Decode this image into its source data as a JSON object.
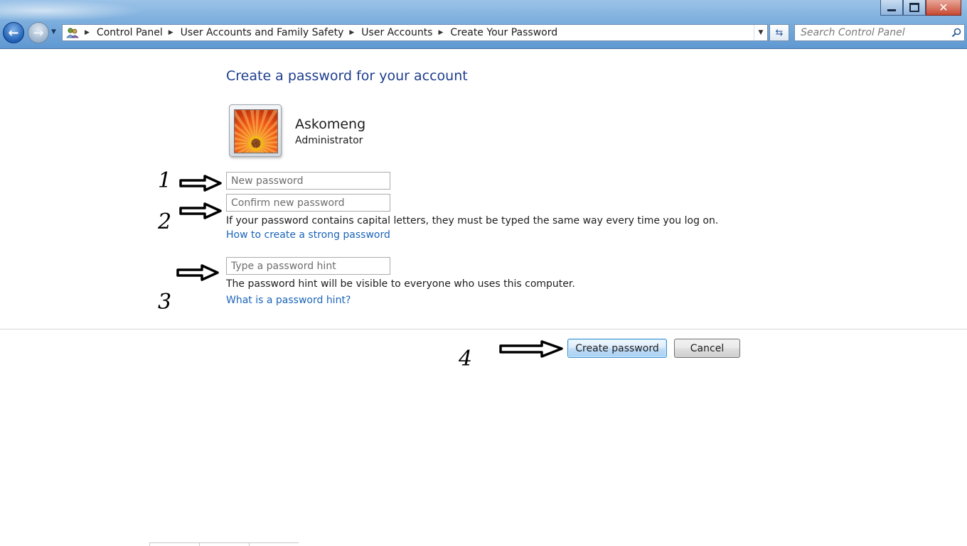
{
  "window": {
    "minimize_label": "",
    "maximize_label": "",
    "close_label": "✕"
  },
  "nav": {
    "back_glyph": "←",
    "forward_glyph": "→",
    "history_glyph": "▼"
  },
  "address_bar": {
    "icon": "control-panel-icon",
    "breadcrumbs": [
      "Control Panel",
      "User Accounts and Family Safety",
      "User Accounts",
      "Create Your Password"
    ],
    "separator_glyph": "▶",
    "dropdown_glyph": "▼",
    "refresh_glyph": "⇆"
  },
  "search": {
    "placeholder": "Search Control Panel"
  },
  "page": {
    "title": "Create a password for your account"
  },
  "user": {
    "name": "Askomeng",
    "role": "Administrator"
  },
  "form": {
    "new_password_placeholder": "New password",
    "confirm_password_placeholder": "Confirm new password",
    "caps_note": "If your password contains capital letters, they must be typed the same way every time you log on.",
    "strong_password_link": "How to create a strong password",
    "hint_placeholder": "Type a password hint",
    "hint_note": "The password hint will be visible to everyone who uses this computer.",
    "hint_link": "What is a password hint?"
  },
  "buttons": {
    "create": "Create password",
    "cancel": "Cancel"
  },
  "annotations": {
    "step1": "1",
    "step2": "2",
    "step3": "3",
    "step4": "4"
  }
}
